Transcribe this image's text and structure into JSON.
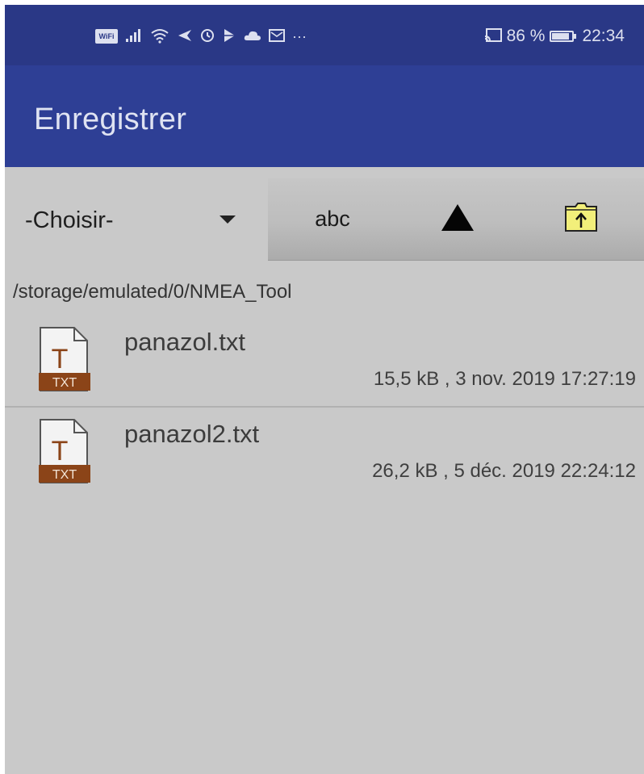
{
  "status_bar": {
    "left_icons": [
      "wifi-badge-icon",
      "signal-icon",
      "wifi-icon",
      "location-icon",
      "alarm-icon",
      "play-store-icon",
      "cloud-icon",
      "mail-icon",
      "more-icon"
    ],
    "wifi_badge_label": "WiFi",
    "more_label": "···",
    "battery_percent_label": "86 %",
    "battery_level": 0.86,
    "time": "22:34"
  },
  "app_bar": {
    "title": "Enregistrer"
  },
  "toolbar": {
    "spinner_value": "-Choisir-",
    "sort_name_label": "abc",
    "sort_order_icon": "triangle-up-icon",
    "parent_folder_icon": "folder-up-icon"
  },
  "path": "/storage/emulated/0/NMEA_Tool",
  "files": [
    {
      "name": "panazol.txt",
      "meta": "15,5 kB , 3 nov. 2019 17:27:19",
      "icon_letter": "T",
      "icon_tag": "TXT"
    },
    {
      "name": "panazol2.txt",
      "meta": "26,2 kB , 5 déc. 2019 22:24:12",
      "icon_letter": "T",
      "icon_tag": "TXT"
    }
  ],
  "colors": {
    "status_bar": "#2a3886",
    "app_bar": "#2e3f95",
    "background": "#c9c9c9",
    "txt_tag": "#8b4418",
    "folder": "#f2ef7a"
  }
}
